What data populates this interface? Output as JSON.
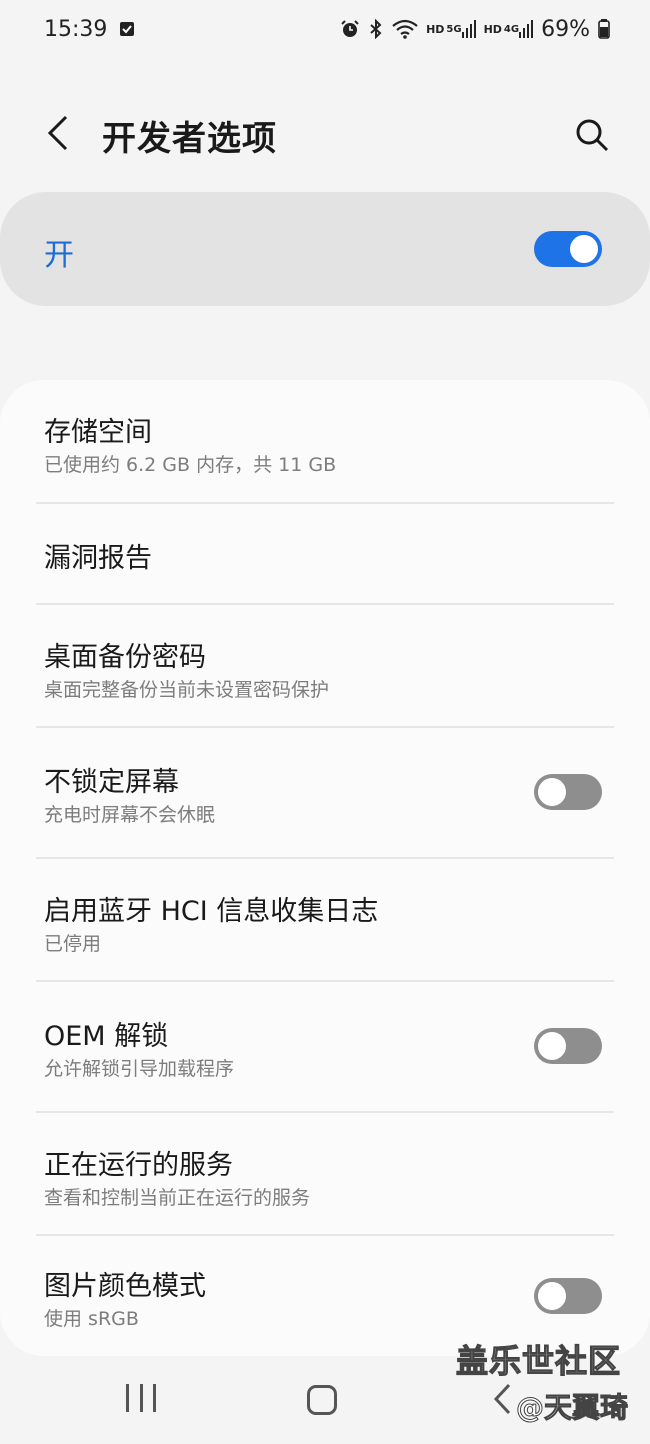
{
  "status_bar": {
    "time": "15:39",
    "network_1": "5G",
    "network_2": "4G",
    "hd": "HD",
    "battery": "69%",
    "icons": [
      "checkbox-notification-icon",
      "alarm-icon",
      "bluetooth-icon",
      "wifi-icon",
      "signal-icon",
      "battery-icon"
    ]
  },
  "header": {
    "title": "开发者选项",
    "back_icon": "chevron-left-icon",
    "search_icon": "search-icon"
  },
  "master_switch": {
    "label": "开",
    "on": true,
    "accent": "#1e74e6"
  },
  "items": [
    {
      "title": "存储空间",
      "subtitle": "已使用约 6.2 GB 内存，共 11 GB",
      "toggle": null
    },
    {
      "title": "漏洞报告",
      "subtitle": "",
      "toggle": null
    },
    {
      "title": "桌面备份密码",
      "subtitle": "桌面完整备份当前未设置密码保护",
      "toggle": null
    },
    {
      "title": "不锁定屏幕",
      "subtitle": "充电时屏幕不会休眠",
      "toggle": false
    },
    {
      "title": "启用蓝牙 HCI 信息收集日志",
      "subtitle": "已停用",
      "toggle": null
    },
    {
      "title": "OEM 解锁",
      "subtitle": "允许解锁引导加载程序",
      "toggle": false
    },
    {
      "title": "正在运行的服务",
      "subtitle": "查看和控制当前正在运行的服务",
      "toggle": null
    },
    {
      "title": "图片颜色模式",
      "subtitle": "使用 sRGB",
      "toggle": false
    }
  ],
  "nav_bar": {
    "icons": [
      "recent-apps-icon",
      "home-icon",
      "back-icon"
    ]
  },
  "watermark": {
    "line1": "盖乐世社区",
    "line2": "@天翼琦"
  }
}
